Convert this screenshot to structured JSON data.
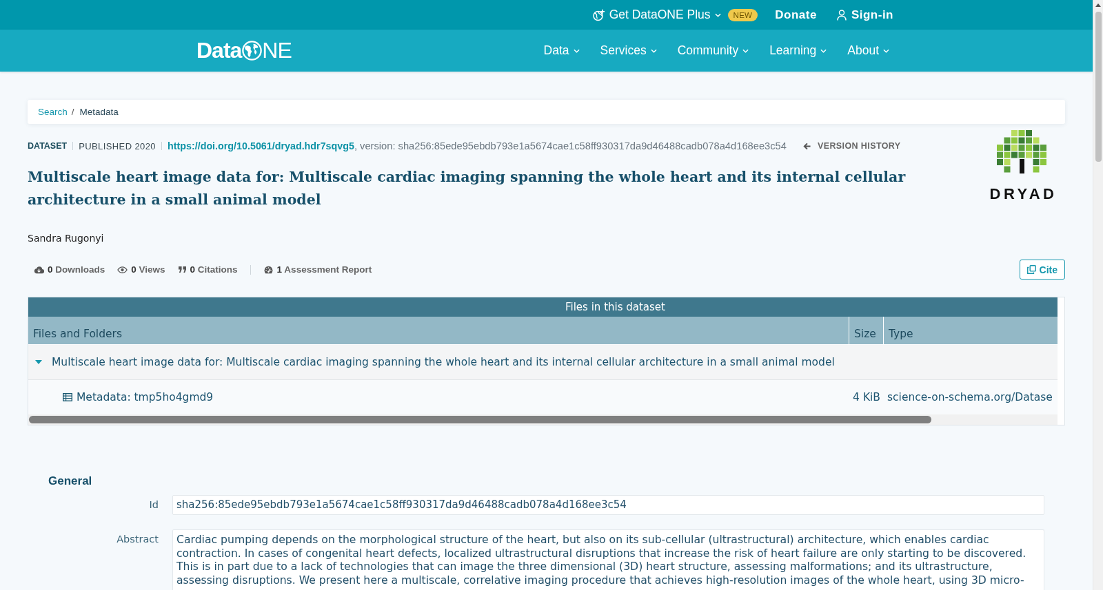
{
  "top_bar": {
    "items": [
      {
        "kind": "plus",
        "label": "Get DataONE Plus",
        "badge": "NEW"
      },
      {
        "kind": "donate",
        "label": "Donate"
      },
      {
        "kind": "signin",
        "label": "Sign-in"
      }
    ]
  },
  "nav": {
    "logo": {
      "lead": "Data",
      "tail": "NE"
    },
    "items": [
      "Data",
      "Services",
      "Community",
      "Learning",
      "About"
    ]
  },
  "breadcrumbs": {
    "separator": "/",
    "items": [
      {
        "kind": "link",
        "label": "Search"
      },
      {
        "kind": "current",
        "label": "Metadata"
      }
    ]
  },
  "dataset": {
    "type": "DATASET",
    "published": "PUBLISHED 2020",
    "doi": "https://doi.org/10.5061/dryad.hdr7sqvg5",
    "version": ", version: sha256:85ede95ebdb793e1a5674cae1c58ff930317da9d46488cadb078a4d168ee3c54",
    "version_history": "VERSION HISTORY",
    "title": "Multiscale heart image data for: Multiscale cardiac imaging spanning the whole heart and its internal cellular architecture in a small animal model",
    "authors": [
      "Sandra Rugonyi"
    ],
    "publisher_logo": "DRYAD"
  },
  "metrics": [
    {
      "kind": "downloads",
      "count": "0",
      "label": "Downloads"
    },
    {
      "kind": "views",
      "count": "0",
      "label": "Views"
    },
    {
      "kind": "citations",
      "count": "0",
      "label": "Citations"
    }
  ],
  "reports": [
    {
      "kind": "assessment",
      "count": "1",
      "label": "Assessment Report"
    }
  ],
  "cite_button": "Cite",
  "files_table": {
    "title": "Files in this dataset",
    "columns": [
      "Files and Folders",
      "Size",
      "Type"
    ],
    "rows": [
      {
        "kind": "folder",
        "name": "Multiscale heart image data for: Multiscale cardiac imaging spanning the whole heart and its internal cellular architecture in a small animal model",
        "expanded": true,
        "children": [
          {
            "kind": "file",
            "name": "Metadata: tmp5ho4gmd9",
            "size": "4 KiB",
            "type": "science-on-schema.org/Datase"
          }
        ]
      }
    ]
  },
  "general": {
    "heading": "General",
    "fields": [
      {
        "kind": "single",
        "label": "Id",
        "value": "sha256:85ede95ebdb793e1a5674cae1c58ff930317da9d46488cadb078a4d168ee3c54"
      },
      {
        "kind": "multi",
        "label": "Abstract",
        "value": "Cardiac pumping depends on the morphological structure of the heart, but also on its sub-cellular (ultrastructural) architecture, which enables cardiac contraction. In cases of congenital heart defects, localized ultrastructural disruptions that increase the risk of heart failure are only starting to be discovered. This is in part due to a lack of technologies that can image the three dimensional (3D) heart structure, assessing malformations; and its ultrastructure, assessing disruptions. We present here a multiscale, correlative imaging procedure that achieves high-resolution images of the whole heart, using 3D micro-"
      }
    ]
  }
}
